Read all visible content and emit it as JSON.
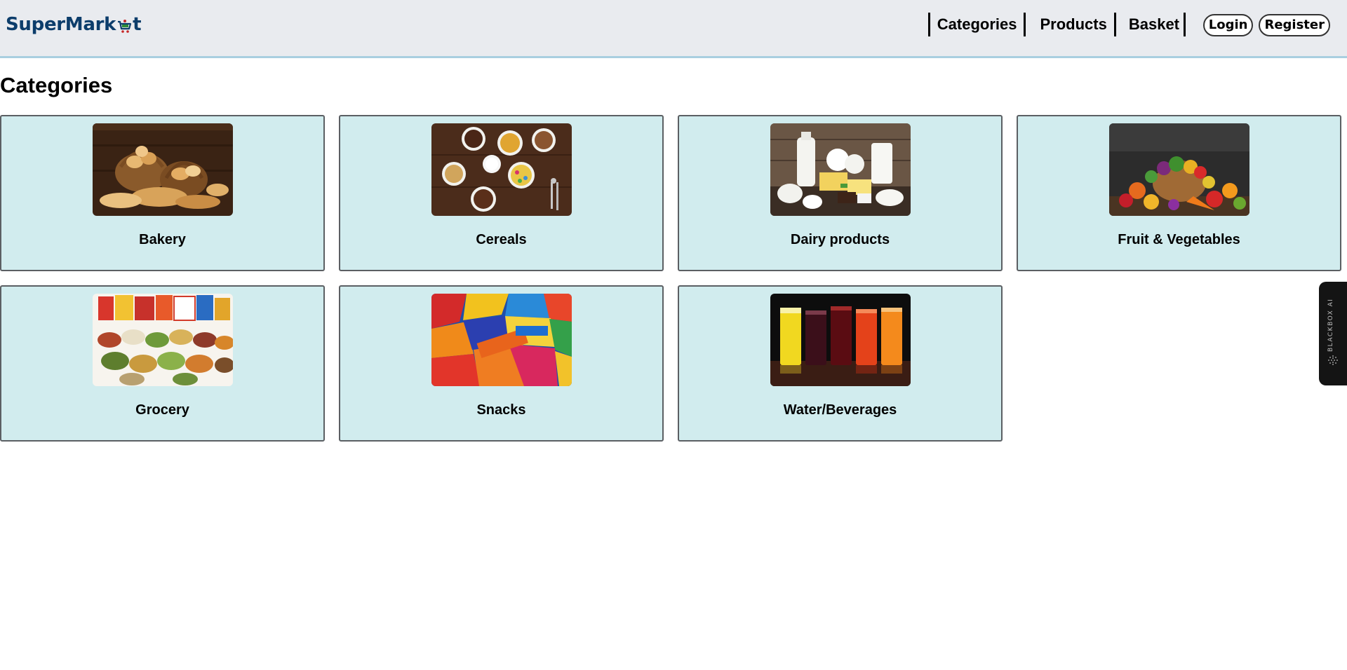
{
  "header": {
    "logo_left": "SuperMark",
    "logo_right": "t",
    "nav": [
      {
        "label": "Categories"
      },
      {
        "label": "Products"
      },
      {
        "label": "Basket"
      }
    ],
    "login_label": "Login",
    "register_label": "Register"
  },
  "main": {
    "title": "Categories",
    "categories": [
      {
        "label": "Bakery",
        "image": "bakery-image"
      },
      {
        "label": "Cereals",
        "image": "cereals-image"
      },
      {
        "label": "Dairy products",
        "image": "dairy-image"
      },
      {
        "label": "Fruit & Vegetables",
        "image": "fruit-vegetables-image"
      },
      {
        "label": "Grocery",
        "image": "grocery-image"
      },
      {
        "label": "Snacks",
        "image": "snacks-image"
      },
      {
        "label": "Water/Beverages",
        "image": "beverages-image"
      }
    ]
  },
  "side_widget": {
    "label": "BLACKBOX AI"
  },
  "colors": {
    "header_bg": "#e9ebef",
    "header_border": "#a9cfe0",
    "logo": "#0c3d6b",
    "card_bg": "#d1ecee",
    "card_border": "#5b5f63"
  }
}
